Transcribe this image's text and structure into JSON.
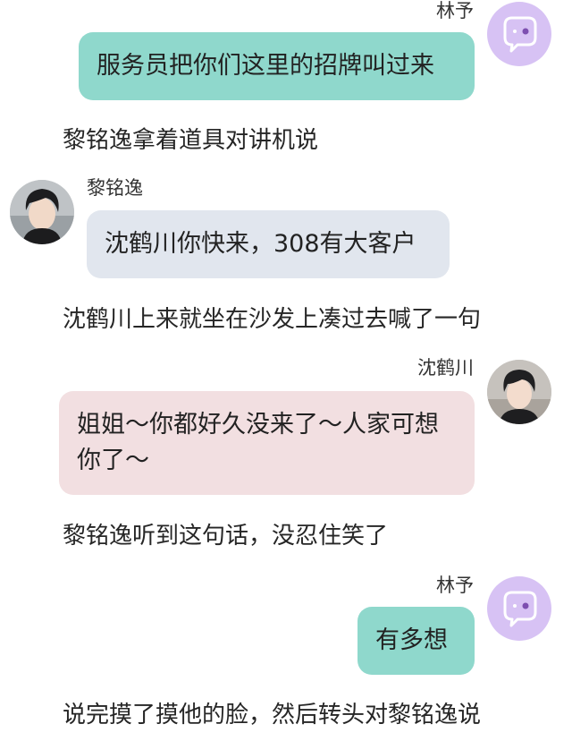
{
  "colors": {
    "self_bubble": "#8fd8cc",
    "other_bubble_1": "#e1e6ee",
    "other_bubble_2": "#f2dfe1",
    "self_avatar": "#d7c2f4"
  },
  "messages": [
    {
      "sender": "林予",
      "text": "服务员把你们这里的招牌叫过来",
      "avatar_icon": "chat-bubble-icon"
    },
    {
      "narration": "黎铭逸拿着道具对讲机说"
    },
    {
      "sender": "黎铭逸",
      "text": "沈鹤川你快来，308有大客户",
      "avatar_icon": "person-photo"
    },
    {
      "narration": "沈鹤川上来就坐在沙发上凑过去喊了一句"
    },
    {
      "sender": "沈鹤川",
      "text_line1": "姐姐～你都好久没来了～人家可想",
      "text_line2": "你了～",
      "avatar_icon": "person-photo"
    },
    {
      "narration": "黎铭逸听到这句话，没忍住笑了"
    },
    {
      "sender": "林予",
      "text": "有多想",
      "avatar_icon": "chat-bubble-icon"
    },
    {
      "narration": "说完摸了摸他的脸，然后转头对黎铭逸说"
    }
  ]
}
